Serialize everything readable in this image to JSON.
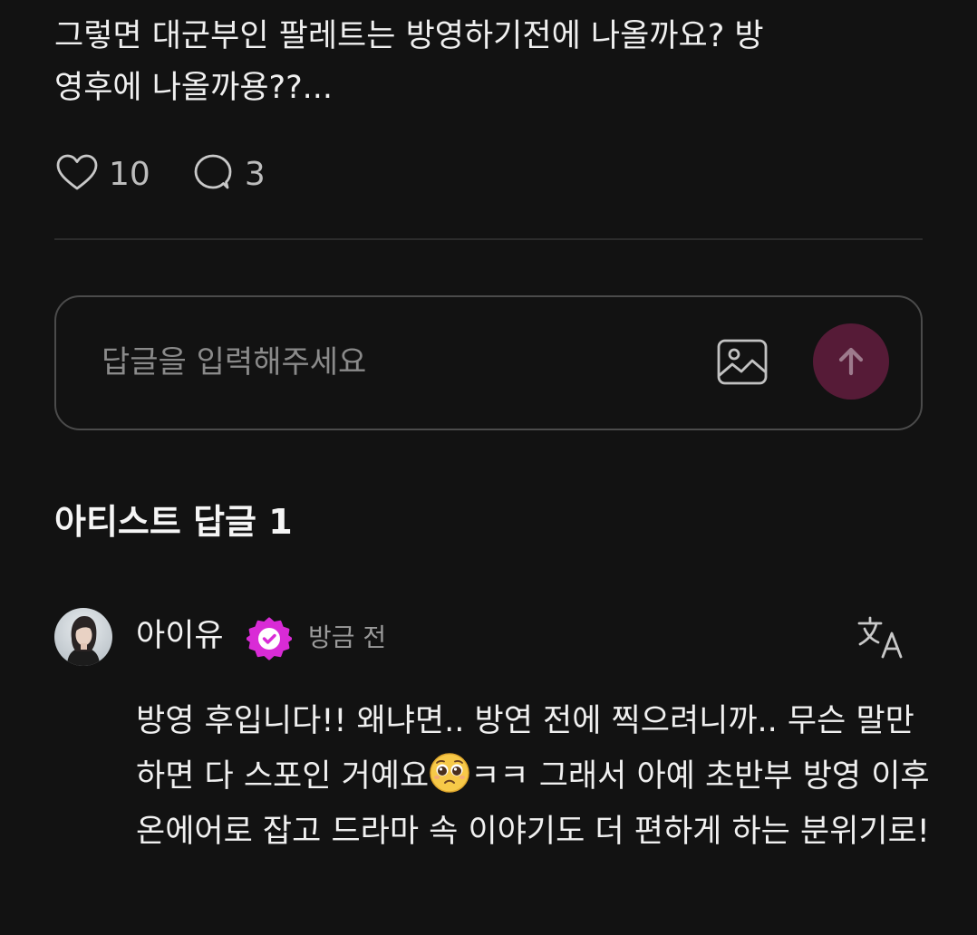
{
  "post": {
    "text": "그렇면 대군부인 팔레트는 방영하기전에 나올까요? 방\n영후에 나올까용??...",
    "like_count": "10",
    "comment_count": "3"
  },
  "reply_box": {
    "placeholder": "답글을 입력해주세요",
    "send_button_color": "#561b37"
  },
  "artist_replies": {
    "heading": "아티스트 답글 1",
    "items": [
      {
        "author": "아이유",
        "time": "방금 전",
        "text_before_emoji": "방영 후입니다!! 왜냐면.. 방연 전에 찍으려니까.. 무슨 말만 하면 다 스포인 거예요",
        "emoji": "pleading-face",
        "text_after_emoji": "ㅋㅋ 그래서 아예 초반부 방영 이후 온에어로 잡고 드라마 속 이야기도 더 편하게 하는 분위기로!"
      }
    ]
  },
  "colors": {
    "background": "#121212",
    "verified_badge": "#d92bd6",
    "muted_text": "#9a9a9a"
  },
  "icons": {
    "like": "heart-outline-icon",
    "comment": "speech-bubble-icon",
    "attach": "image-icon",
    "send": "arrow-up-icon",
    "verified": "verified-badge-icon",
    "translate": "translate-icon"
  }
}
